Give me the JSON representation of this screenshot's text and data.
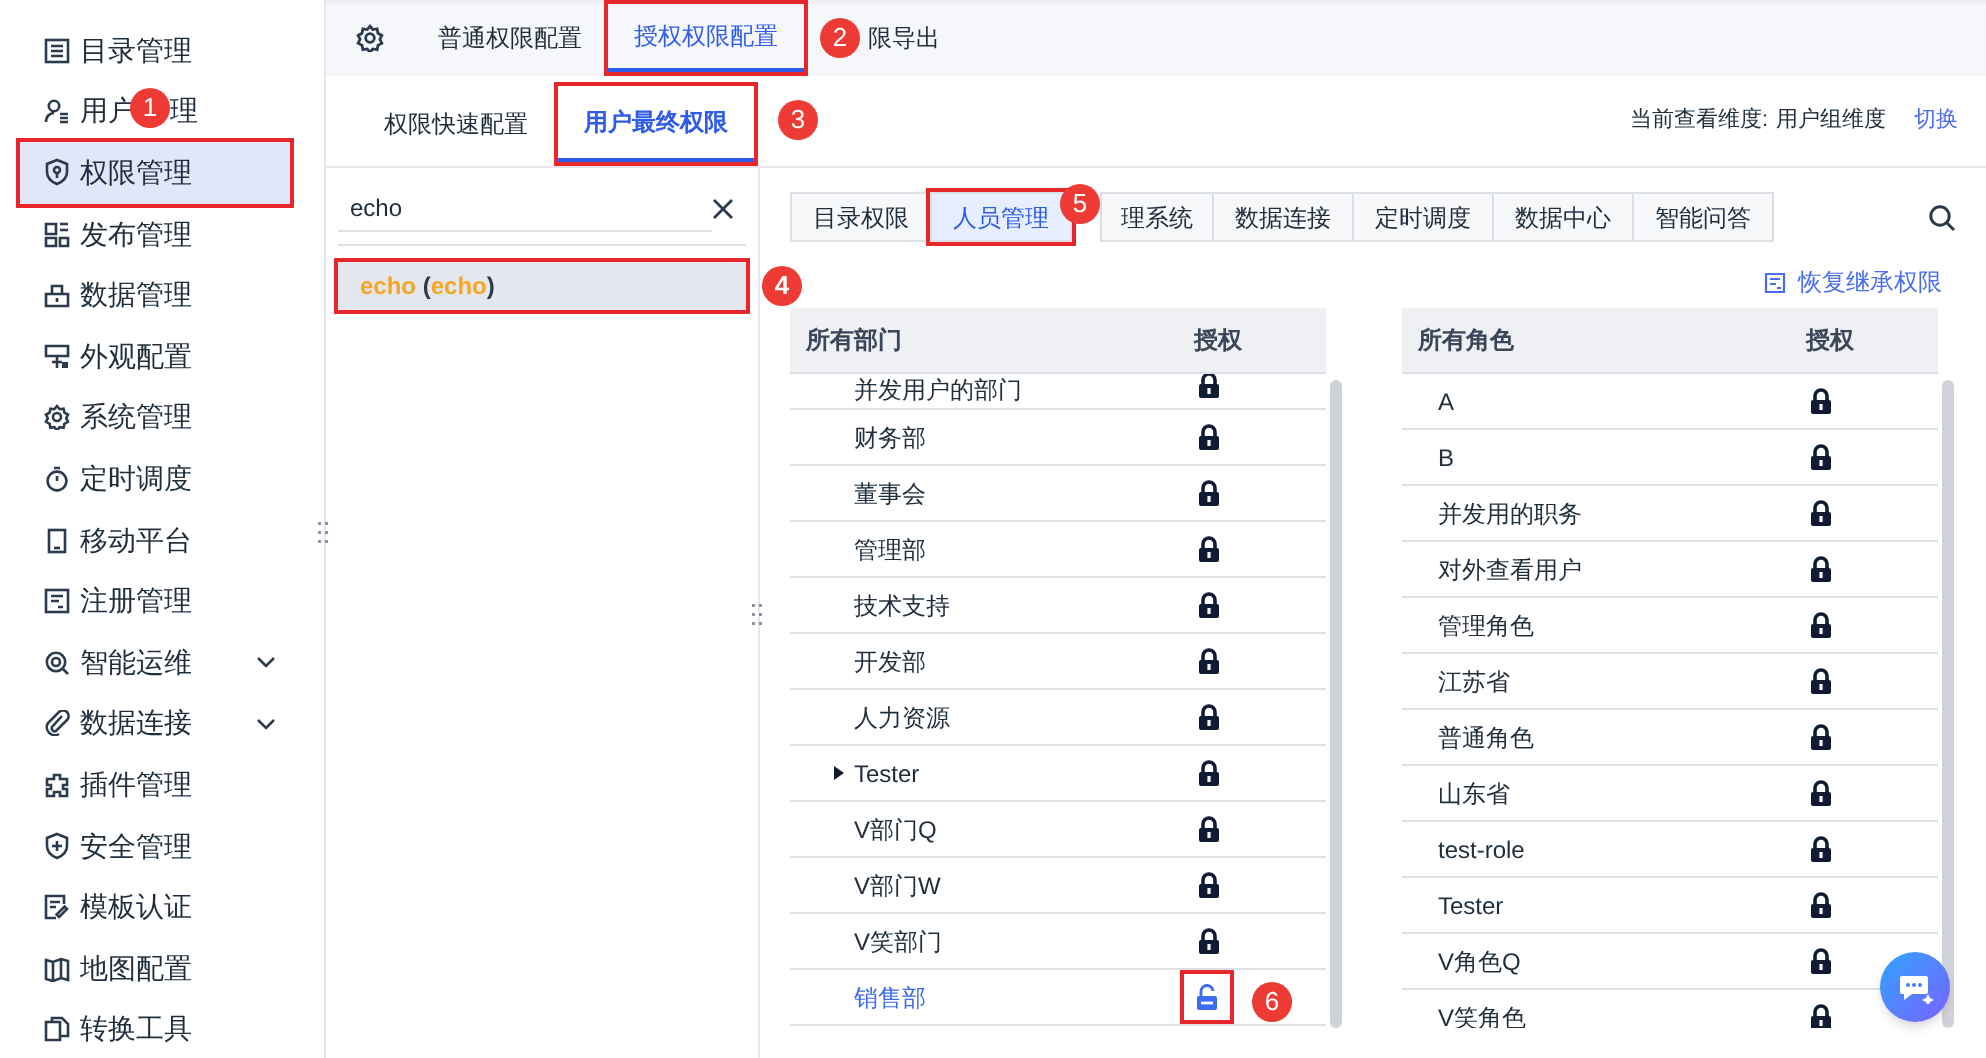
{
  "sidebar": {
    "items": [
      {
        "label": "目录管理",
        "kind": "page",
        "selected": false,
        "outlined": false
      },
      {
        "label": "用户",
        "label_tail": "理",
        "kind": "page",
        "selected": false,
        "outlined": false,
        "callout": "1"
      },
      {
        "label": "权限管理",
        "kind": "page",
        "selected": true,
        "outlined": true
      },
      {
        "label": "发布管理",
        "kind": "page",
        "selected": false,
        "outlined": false
      },
      {
        "label": "数据管理",
        "kind": "page",
        "selected": false,
        "outlined": false
      },
      {
        "label": "外观配置",
        "kind": "page",
        "selected": false,
        "outlined": false
      },
      {
        "label": "系统管理",
        "kind": "page",
        "selected": false,
        "outlined": false
      },
      {
        "label": "定时调度",
        "kind": "page",
        "selected": false,
        "outlined": false
      },
      {
        "label": "移动平台",
        "kind": "page",
        "selected": false,
        "outlined": false
      },
      {
        "label": "注册管理",
        "kind": "page",
        "selected": false,
        "outlined": false
      },
      {
        "label": "智能运维",
        "kind": "group",
        "selected": false,
        "outlined": false
      },
      {
        "label": "数据连接",
        "kind": "group",
        "selected": false,
        "outlined": false
      },
      {
        "label": "插件管理",
        "kind": "page",
        "selected": false,
        "outlined": false
      },
      {
        "label": "安全管理",
        "kind": "page",
        "selected": false,
        "outlined": false
      },
      {
        "label": "模板认证",
        "kind": "page",
        "selected": false,
        "outlined": false
      },
      {
        "label": "地图配置",
        "kind": "page",
        "selected": false,
        "outlined": false
      },
      {
        "label": "转换工具",
        "kind": "page",
        "selected": false,
        "outlined": false
      }
    ]
  },
  "top_tabs": [
    {
      "label": "普通权限配置",
      "selected": false,
      "outlined": false
    },
    {
      "label": "授权权限配置",
      "selected": true,
      "outlined": true
    },
    {
      "label": "限导出",
      "selected": false,
      "outlined": false,
      "callout": "2"
    }
  ],
  "sub_tabs": [
    {
      "label": "权限快速配置",
      "selected": false,
      "outlined": false
    },
    {
      "label": "用户最终权限",
      "selected": true,
      "outlined": true,
      "callout": "3"
    }
  ],
  "dimension": {
    "label": "当前查看维度:",
    "value": "用户组维度",
    "switch": "切换"
  },
  "user_search": {
    "value": "echo"
  },
  "users": [
    {
      "parts": [
        {
          "text": "echo",
          "match": true
        },
        {
          "text": " (",
          "match": false
        },
        {
          "text": "echo",
          "match": true
        },
        {
          "text": ")",
          "match": false
        }
      ],
      "selected": true,
      "outlined": true,
      "callout": "4"
    }
  ],
  "resource_tabs": [
    {
      "label": "目录权限",
      "selected": false,
      "outlined": false
    },
    {
      "label": "人员管理",
      "selected": true,
      "outlined": true
    },
    {
      "label": "理系统",
      "selected": false,
      "outlined": false,
      "callout": "5"
    },
    {
      "label": "数据连接",
      "selected": false,
      "outlined": false
    },
    {
      "label": "定时调度",
      "selected": false,
      "outlined": false
    },
    {
      "label": "数据中心",
      "selected": false,
      "outlined": false
    },
    {
      "label": "智能问答",
      "selected": false,
      "outlined": false
    }
  ],
  "restore_link": "恢复继承权限",
  "departments": {
    "columns": [
      "所有部门",
      "授权"
    ],
    "rows": [
      {
        "name": "并发用户的部门",
        "locked": true,
        "selected": false,
        "has_children": false,
        "outlined": false
      },
      {
        "name": "财务部",
        "locked": true,
        "selected": false,
        "has_children": false,
        "outlined": false
      },
      {
        "name": "董事会",
        "locked": true,
        "selected": false,
        "has_children": false,
        "outlined": false
      },
      {
        "name": "管理部",
        "locked": true,
        "selected": false,
        "has_children": false,
        "outlined": false
      },
      {
        "name": "技术支持",
        "locked": true,
        "selected": false,
        "has_children": false,
        "outlined": false
      },
      {
        "name": "开发部",
        "locked": true,
        "selected": false,
        "has_children": false,
        "outlined": false
      },
      {
        "name": "人力资源",
        "locked": true,
        "selected": false,
        "has_children": false,
        "outlined": false
      },
      {
        "name": "Tester",
        "locked": true,
        "selected": false,
        "has_children": true,
        "outlined": false
      },
      {
        "name": "V部门Q",
        "locked": true,
        "selected": false,
        "has_children": false,
        "outlined": false
      },
      {
        "name": "V部门W",
        "locked": true,
        "selected": false,
        "has_children": false,
        "outlined": false
      },
      {
        "name": "V笑部门",
        "locked": true,
        "selected": false,
        "has_children": false,
        "outlined": false
      },
      {
        "name": "销售部",
        "locked": false,
        "selected": true,
        "has_children": false,
        "outlined": true,
        "callout": "6"
      }
    ]
  },
  "roles": {
    "columns": [
      "所有角色",
      "授权"
    ],
    "rows": [
      {
        "name": "A",
        "locked": true
      },
      {
        "name": "B",
        "locked": true
      },
      {
        "name": "并发用的职务",
        "locked": true
      },
      {
        "name": "对外查看用户",
        "locked": true
      },
      {
        "name": "管理角色",
        "locked": true
      },
      {
        "name": "江苏省",
        "locked": true
      },
      {
        "name": "普通角色",
        "locked": true
      },
      {
        "name": "山东省",
        "locked": true
      },
      {
        "name": "test-role",
        "locked": true
      },
      {
        "name": "Tester",
        "locked": true
      },
      {
        "name": "V角色Q",
        "locked": true
      },
      {
        "name": "V笑角色",
        "locked": true
      }
    ]
  }
}
